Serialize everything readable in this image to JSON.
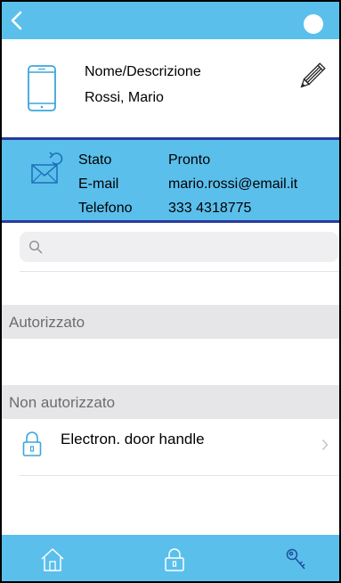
{
  "header": {
    "name_label": "Nome/Descrizione",
    "name_value": "Rossi,  Mario"
  },
  "info": {
    "rows": [
      {
        "key": "Stato",
        "value": "Pronto"
      },
      {
        "key": "E-mail",
        "value": "mario.rossi@email.it"
      },
      {
        "key": "Telefono",
        "value": "333 4318775"
      }
    ]
  },
  "search": {
    "placeholder": "",
    "value": ""
  },
  "sections": {
    "authorized": "Autorizzato",
    "not_authorized": "Non autorizzato"
  },
  "items": [
    {
      "label": "Electron. door handle"
    }
  ],
  "icons": {
    "back": "back-chevron-icon",
    "status": "status-dot-icon",
    "device": "smartphone-icon",
    "edit": "pencil-icon",
    "mail": "mail-sync-icon",
    "search": "search-icon",
    "lock": "padlock-icon",
    "chevron": "chevron-right-icon",
    "tab_home": "home-icon",
    "tab_lock": "padlock-icon",
    "tab_key": "key-icon"
  },
  "colors": {
    "accent": "#5bbfec",
    "band_border": "#2a3a9e",
    "section_bg": "#e6e6e8"
  }
}
